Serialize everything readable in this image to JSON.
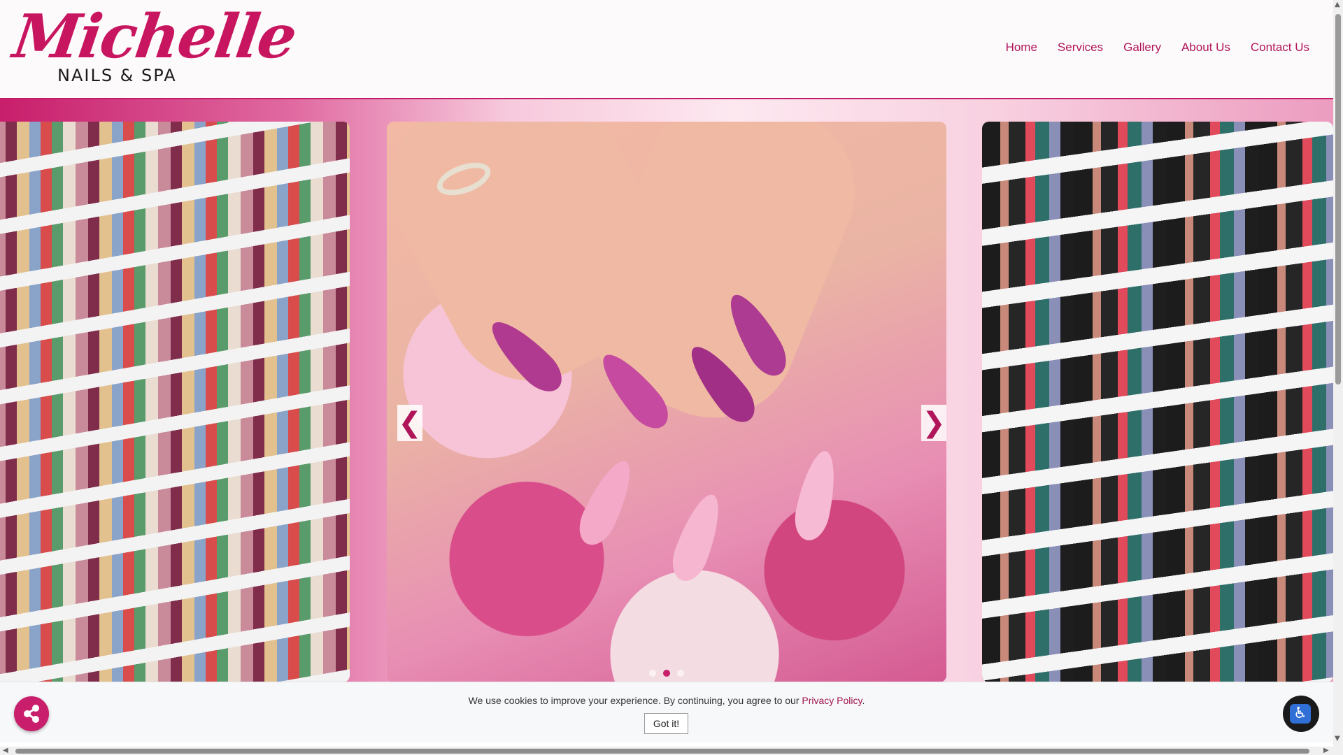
{
  "header": {
    "logo_script": "Michelle",
    "logo_sub": "NAILS & SPA",
    "nav": [
      "Home",
      "Services",
      "Gallery",
      "About Us",
      "Contact Us"
    ]
  },
  "slider": {
    "prev_label": "❮",
    "next_label": "❯",
    "slides": [
      {
        "image": "nail-powder-shelves"
      },
      {
        "image": "pink-manicure-with-flowers"
      },
      {
        "image": "xo-perfect-matching-shelves"
      }
    ],
    "dots": 3,
    "active_dot": 1
  },
  "cookie": {
    "text": "We use cookies to improve your experience. By continuing, you agree to our ",
    "link": "Privacy Policy",
    "suffix": ".",
    "button": "Got it!"
  },
  "icons": {
    "share": "share-icon",
    "accessibility": "accessibility-icon"
  },
  "colors": {
    "brand": "#c81e6b",
    "nav_text": "#b0155a"
  }
}
